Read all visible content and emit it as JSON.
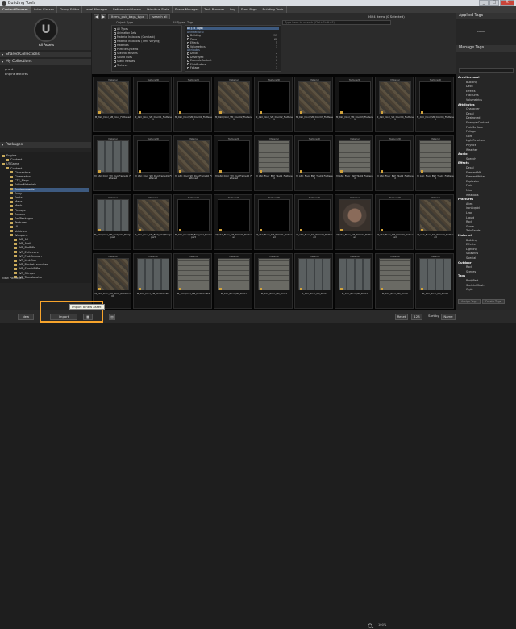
{
  "window": {
    "title": "Building Tools",
    "buttons": [
      "_",
      "□",
      "X"
    ]
  },
  "tabs": [
    "Content Browser",
    "Actor Classes",
    "Group Editor",
    "Level Manager",
    "Referenced Assets",
    "Primitive Stats",
    "Scene Manager",
    "Task Browser",
    "Log",
    "Start Page",
    "Building Tools"
  ],
  "left": {
    "all_assets": "All Assets",
    "shared_collections": "Shared Collections",
    "my_collections": "My Collections",
    "collection_items": [
      "grunt",
      "EngineTextures"
    ],
    "packages": "Packages",
    "tree": [
      {
        "label": "Engine",
        "indent": 0,
        "selected": false
      },
      {
        "label": "Content",
        "indent": 1,
        "selected": false
      },
      {
        "label": "UTGame",
        "indent": 0,
        "selected": false
      },
      {
        "label": "Content",
        "indent": 1,
        "selected": false
      },
      {
        "label": "Characters",
        "indent": 2,
        "selected": false
      },
      {
        "label": "Cinematics",
        "indent": 2,
        "selected": false
      },
      {
        "label": "CTF_Flags",
        "indent": 2,
        "selected": false
      },
      {
        "label": "EditorMaterials",
        "indent": 2,
        "selected": false
      },
      {
        "label": "Environments",
        "indent": 2,
        "selected": true
      },
      {
        "label": "Envy",
        "indent": 2,
        "selected": false
      },
      {
        "label": "Fonts",
        "indent": 2,
        "selected": false
      },
      {
        "label": "Maps",
        "indent": 2,
        "selected": false
      },
      {
        "label": "Mesh",
        "indent": 2,
        "selected": false
      },
      {
        "label": "Pickups",
        "indent": 2,
        "selected": false
      },
      {
        "label": "Sounds",
        "indent": 2,
        "selected": false
      },
      {
        "label": "SwfPackages",
        "indent": 2,
        "selected": false
      },
      {
        "label": "Textures",
        "indent": 2,
        "selected": false
      },
      {
        "label": "UI",
        "indent": 2,
        "selected": false
      },
      {
        "label": "Vehicles",
        "indent": 2,
        "selected": false
      },
      {
        "label": "Weapons",
        "indent": 2,
        "selected": false
      },
      {
        "label": "WP_All",
        "indent": 3,
        "selected": false
      },
      {
        "label": "WP_Avril",
        "indent": 3,
        "selected": false
      },
      {
        "label": "WP_BioRifle",
        "indent": 3,
        "selected": false
      },
      {
        "label": "WP_Enforcers",
        "indent": 3,
        "selected": false
      },
      {
        "label": "WP_FlakCannon",
        "indent": 3,
        "selected": false
      },
      {
        "label": "WP_LinkGun",
        "indent": 3,
        "selected": false
      },
      {
        "label": "WP_RocketLauncher",
        "indent": 3,
        "selected": false
      },
      {
        "label": "WP_ShockRifle",
        "indent": 3,
        "selected": false
      },
      {
        "label": "WP_Stinger",
        "indent": 3,
        "selected": false
      },
      {
        "label": "WP_Translocator",
        "indent": 3,
        "selected": false
      }
    ],
    "new_packages": "New Packages"
  },
  "filter": {
    "crumbs": [
      "Items_pub_bags_type",
      "search all"
    ],
    "asset_count": "2624 Items (0 Selected)",
    "search_placeholder": "Type here to search (Ctrl+Shift+F)",
    "type_header": "Object Type",
    "all_types_label": "All Types",
    "types": [
      "Animation Sets",
      "Material Instances (Constant)",
      "Material Instances (Time Varying)",
      "Materials",
      "Particle Systems",
      "Skeletal Meshes",
      "Sound Cues",
      "Static Meshes",
      "Textures"
    ],
    "tags_header": "Tags",
    "tags_selected": "All (15 Tags)",
    "tag_groups": [
      {
        "group": "Architectural",
        "items": [
          {
            "name": "Building",
            "count": "293"
          },
          {
            "name": "Deco",
            "count": "68"
          },
          {
            "name": "Effects",
            "count": "5"
          },
          {
            "name": "Volumetrics",
            "count": "3"
          }
        ]
      },
      {
        "group": "Attributes",
        "items": [
          {
            "name": "Decal",
            "count": "2"
          },
          {
            "name": "Destroyed",
            "count": "4"
          },
          {
            "name": "ExampleContent",
            "count": "6"
          },
          {
            "name": "FluidSurface",
            "count": "2"
          },
          {
            "name": "Foliage",
            "count": "3"
          }
        ]
      }
    ]
  },
  "grid": {
    "cells": [
      {
        "type": "Material",
        "tex": "mat",
        "name": "M_ASC_Door_SM_Door_Flattened"
      },
      {
        "type": "Texture2D",
        "tex": "black",
        "name": "M_ASC_Door_SM_Door01_Flattened"
      },
      {
        "type": "Texture2D",
        "tex": "black",
        "name": "M_ASC_Door_SM_Door01_Flattened"
      },
      {
        "type": "Material",
        "tex": "mat",
        "name": "M_ASC_Door_SM_Door02_Flattened"
      },
      {
        "type": "Texture2D",
        "tex": "black",
        "name": "M_ASC_Door_SM_Door02_Flattened"
      },
      {
        "type": "Material",
        "tex": "mat",
        "name": "M_ASC_Door_SM_Door03_Flattened"
      },
      {
        "type": "Texture2D",
        "tex": "black",
        "name": "M_ASC_Door_SM_Door03_Flattened"
      },
      {
        "type": "Material",
        "tex": "mat",
        "name": "M_ASC_Door_SM_Door04_Flattened"
      },
      {
        "type": "Texture2D",
        "tex": "black",
        "name": "M_ASC_Door_SM_Door04_Flattened"
      },
      {
        "type": "Material",
        "tex": "metal",
        "name": "M_ASC_Door_SM_DoorFrame01_Flattened"
      },
      {
        "type": "Texture2D",
        "tex": "black",
        "name": "M_ASC_Door_SM_DoorFrame01_Flattened"
      },
      {
        "type": "Material",
        "tex": "mat",
        "name": "M_ASC_Door_SM_DoorFrame02_Flattened"
      },
      {
        "type": "Texture2D",
        "tex": "black",
        "name": "M_ASC_Door_SM_DoorFrame02_Flattened"
      },
      {
        "type": "Material",
        "tex": "stone",
        "name": "M_ASC_Floor_BSP_Tile01_Flattened"
      },
      {
        "type": "Texture2D",
        "tex": "black",
        "name": "M_ASC_Floor_BSP_Tile01_Flattened"
      },
      {
        "type": "Material",
        "tex": "stone",
        "name": "M_ASC_Floor_BSP_Tile02_Flattened"
      },
      {
        "type": "Texture2D",
        "tex": "black",
        "name": "M_ASC_Floor_BSP_Tile02_Flattened"
      },
      {
        "type": "Material",
        "tex": "stone",
        "name": "M_ASC_Floor_BSP_Tile03_Flattened"
      },
      {
        "type": "Material",
        "tex": "metal",
        "name": "M_ASC_Door_SM_Bridge01_Bridgepart"
      },
      {
        "type": "Material",
        "tex": "mat",
        "name": "M_ASC_Door_SM_Bridge02_Bridgepart"
      },
      {
        "type": "Texture2D",
        "tex": "black",
        "name": "M_ASC_Door_SM_Bridge02_Bridgepart"
      },
      {
        "type": "Texture2D",
        "tex": "black",
        "name": "M_ASC_Floor_SM_Walls01_Flattened"
      },
      {
        "type": "Texture2D",
        "tex": "black",
        "name": "M_ASC_Floor_SM_Walls01_Flattened"
      },
      {
        "type": "Texture2D",
        "tex": "black",
        "name": "M_ASC_Floor_SM_Walls02_Flattened"
      },
      {
        "type": "Material",
        "tex": "ceil",
        "name": "M_ASC_Floor_SM_Walls02_Flattened"
      },
      {
        "type": "Texture2D",
        "tex": "black",
        "name": "M_ASC_Floor_SM_Walls03_Flattened"
      },
      {
        "type": "Material",
        "tex": "mat",
        "name": "M_ASC_Floor_SM_Walls03_Flattened"
      },
      {
        "type": "Material",
        "tex": "mat",
        "name": "M_ASC_Door_SM_Walls_WallRelief01"
      },
      {
        "type": "Material",
        "tex": "metal",
        "name": "M_ASC_Door_SM_WallRelief02"
      },
      {
        "type": "Material",
        "tex": "stone",
        "name": "M_ASC_Door_SM_WallRelief03"
      },
      {
        "type": "Material",
        "tex": "stone",
        "name": "M_ASC_Floor_SM_Tile01"
      },
      {
        "type": "Material",
        "tex": "stone",
        "name": "M_ASC_Floor_SM_Tile02"
      },
      {
        "type": "Material",
        "tex": "metal",
        "name": "M_ASC_Floor_SM_Tile03"
      },
      {
        "type": "Material",
        "tex": "metal",
        "name": "M_ASC_Floor_SM_Tile04"
      },
      {
        "type": "Material",
        "tex": "stone",
        "name": "M_ASC_Floor_SM_Tile05"
      },
      {
        "type": "Material",
        "tex": "metal",
        "name": "M_ASC_Floor_SM_Tile06"
      }
    ]
  },
  "right": {
    "applied_tags": "Applied Tags",
    "none": "none",
    "manage_tags": "Manage Tags",
    "groups": [
      {
        "group": "Architectural",
        "items": [
          "Building",
          "Deco",
          "Effects",
          "Fractures",
          "Volumetrics"
        ]
      },
      {
        "group": "Attributes",
        "items": [
          "Character",
          "Decal",
          "Destroyed",
          "ExampleContent",
          "FluidSurface",
          "Foliage",
          "Gore",
          "LightFunction",
          "Physics",
          "Weather"
        ]
      },
      {
        "group": "Audio",
        "items": [
          "Speech"
        ]
      },
      {
        "group": "Effects",
        "items": [
          "Decal",
          "ElementMtl",
          "ElementWater",
          "Explosion",
          "Fluid",
          "Misc",
          "Weapons"
        ]
      },
      {
        "group": "Fractures",
        "items": [
          "Alien",
          "ironLiquid",
          "Lead",
          "Liquid",
          "Rock",
          "Stone",
          "TwinSeeds"
        ]
      },
      {
        "group": "Material",
        "items": [
          "Building",
          "Effects",
          "Lighting",
          "Splashes",
          "Special"
        ]
      },
      {
        "group": "Outdoor",
        "items": [
          "Rock",
          "Scenes"
        ]
      },
      {
        "group": "Tags",
        "items": [
          "BodyPart",
          "SkeletalMesh",
          "Style"
        ]
      }
    ],
    "btn_assign": "Assign Tags",
    "btn_create": "Create Tags"
  },
  "bottom": {
    "new_label": "New",
    "import_label": "Import",
    "tooltip": "Import a new asset",
    "zoom_text": "100%",
    "reset_label": "Reset",
    "count_value": "128",
    "sort_label": "Sort by",
    "sort_value": "Name"
  }
}
